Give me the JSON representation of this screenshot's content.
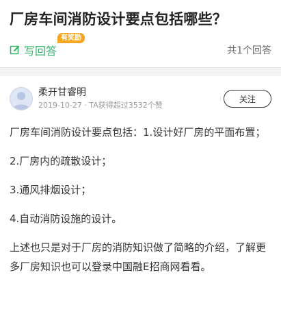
{
  "question": {
    "title": "厂房车间消防设计要点包括哪些？",
    "write_answer_label": "写回答",
    "reward_badge": "有奖励",
    "answer_count_text": "共1个回答"
  },
  "answer": {
    "author_name": "柔开甘睿明",
    "meta_text": "2019-10-27 · TA获得超过3532个赞",
    "follow_label": "关注",
    "paragraphs": [
      "厂房车间消防设计要点包括：1.设计好厂房的平面布置；",
      "2.厂房内的疏散设计；",
      "3.通风排烟设计；",
      "4.自动消防设施的设计。",
      "上述也只是对于厂房的消防知识做了简略的介绍，了解更多厂房知识也可以登录中国融E招商网看看。"
    ]
  },
  "colors": {
    "accent_green": "#2db366",
    "badge_orange": "#f5a623"
  },
  "icons": {
    "write": "edit-icon",
    "avatar": "user-avatar-icon"
  }
}
